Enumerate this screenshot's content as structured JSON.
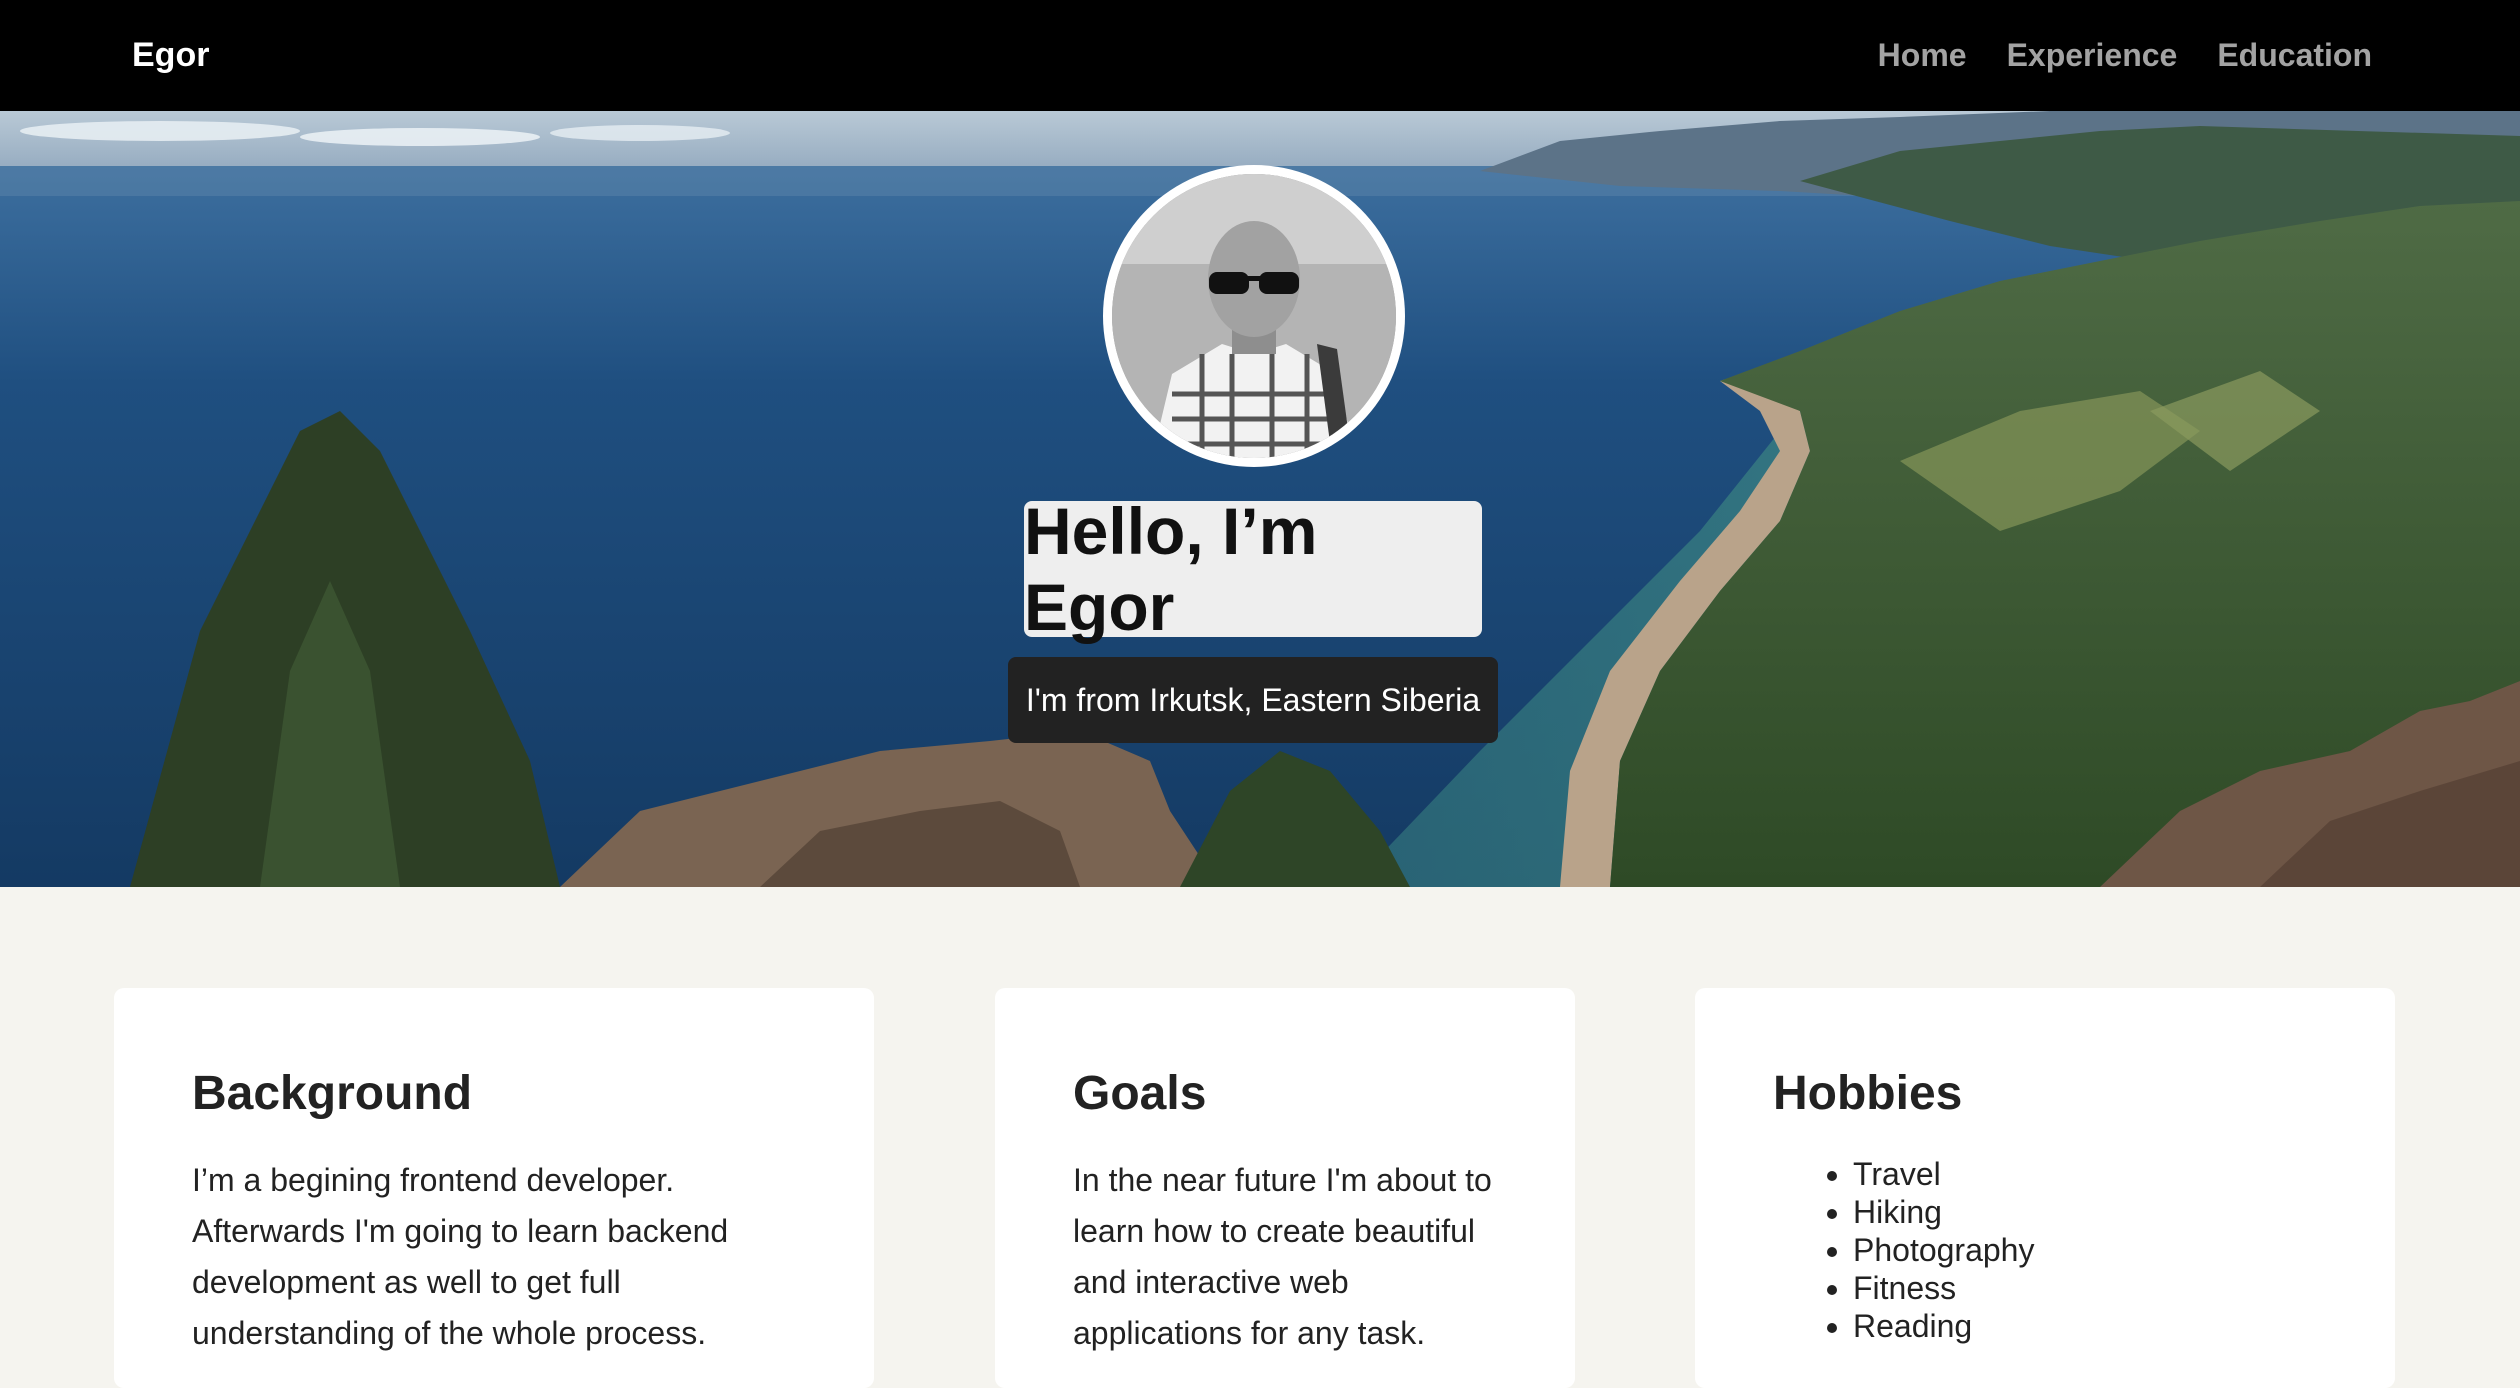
{
  "navbar": {
    "brand": "Egor",
    "links": [
      {
        "label": "Home"
      },
      {
        "label": "Experience"
      },
      {
        "label": "Education"
      }
    ]
  },
  "hero": {
    "title": "Hello, I’m Egor",
    "subtitle": "I'm from Irkutsk, Eastern Siberia"
  },
  "cards": {
    "background": {
      "heading": "Background",
      "text": "I’m a begining frontend developer. Afterwards I'm going to learn backend development as well to get full understanding of the whole process."
    },
    "goals": {
      "heading": "Goals",
      "text": "In the near future I'm about to learn how to create beautiful and interactive web applications for any task."
    },
    "hobbies": {
      "heading": "Hobbies",
      "items": [
        "Travel",
        "Hiking",
        "Photography",
        "Fitness",
        "Reading"
      ]
    }
  },
  "colors": {
    "navbar_bg": "#000000",
    "nav_link": "#a3a3a3",
    "page_bg": "#f5f4ef",
    "card_bg": "#ffffff"
  }
}
